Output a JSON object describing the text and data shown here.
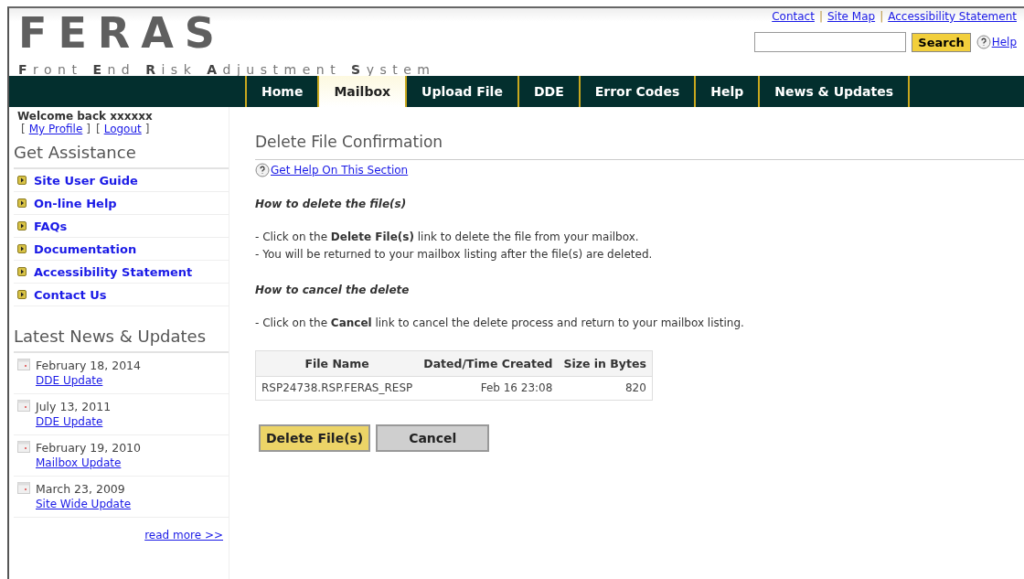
{
  "header": {
    "logo": "FERAS",
    "subtitle": "**F**ront **E**nd **R**isk **A**djustment **S**ystem",
    "top_links": [
      "Contact",
      "Site Map",
      "Accessibility Statement"
    ],
    "top_link_separator": "|",
    "search": {
      "button": "Search"
    },
    "help_link": "Help"
  },
  "nav": {
    "tabs": [
      {
        "label": "Home",
        "selected": false
      },
      {
        "label": "Mailbox",
        "selected": true
      },
      {
        "label": "Upload File",
        "selected": false
      },
      {
        "label": "DDE",
        "selected": false
      },
      {
        "label": "Error Codes",
        "selected": false
      },
      {
        "label": "Help",
        "selected": false
      },
      {
        "label": "News & Updates",
        "selected": false
      }
    ]
  },
  "sidebar": {
    "welcome": "Welcome back xxxxxx",
    "account_links": [
      {
        "open": "[",
        "label": "My Profile",
        "close": "]"
      },
      {
        "open": "[",
        "label": "Logout",
        "close": "]"
      }
    ],
    "assistance": {
      "title": "Get Assistance",
      "items": [
        "Site User Guide",
        "On-line Help",
        "FAQs",
        "Documentation",
        "Accessibility Statement",
        "Contact Us"
      ]
    },
    "news": {
      "title": "Latest News & Updates",
      "items": [
        {
          "date": "February 18, 2014",
          "link": "DDE Update"
        },
        {
          "date": "July 13, 2011",
          "link": "DDE Update"
        },
        {
          "date": "February 19, 2010",
          "link": "Mailbox Update"
        },
        {
          "date": "March 23, 2009",
          "link": "Site Wide Update"
        }
      ],
      "read_more": "read more >>"
    }
  },
  "content": {
    "title": "Delete File Confirmation",
    "help_link": "Get Help On This Section",
    "sections": [
      {
        "heading": "How to delete the file(s)",
        "lines": [
          "- Click on the **Delete File(s)** link to delete the file from your mailbox.",
          "- You will be returned to your mailbox listing after the file(s) are deleted."
        ]
      },
      {
        "heading": "How to cancel the delete",
        "lines": [
          "- Click on the **Cancel** link to cancel the delete process and return to your mailbox listing."
        ]
      }
    ],
    "table": {
      "columns": [
        "File Name",
        "Dated/Time Created",
        "Size in Bytes"
      ],
      "rows": [
        [
          "RSP24738.RSP.FERAS_RESP",
          "Feb 16 23:08",
          "820"
        ]
      ]
    },
    "buttons": [
      {
        "label": "Delete File(s)",
        "kind": "primary"
      },
      {
        "label": "Cancel",
        "kind": "secondary"
      }
    ]
  }
}
